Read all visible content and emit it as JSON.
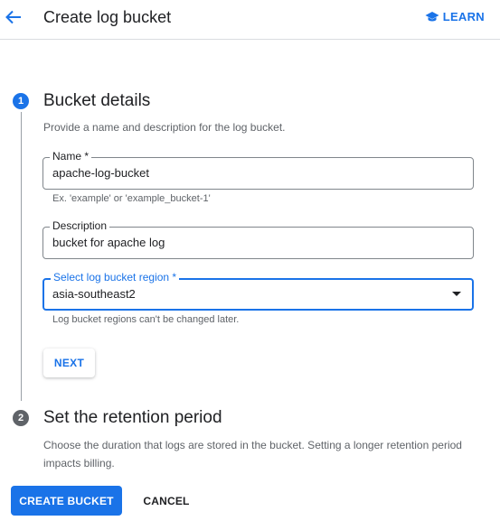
{
  "header": {
    "title": "Create log bucket",
    "learn_label": "LEARN",
    "back_icon": "arrow-left-icon",
    "learn_icon": "school-cap-icon"
  },
  "steps": [
    {
      "number": "1",
      "title": "Bucket details",
      "description": "Provide a name and description for the log bucket."
    },
    {
      "number": "2",
      "title": "Set the retention period",
      "description": "Choose the duration that logs are stored in the bucket. Setting a longer retention period impacts billing."
    }
  ],
  "form": {
    "name": {
      "label": "Name *",
      "value": "apache-log-bucket",
      "hint": "Ex. 'example' or 'example_bucket-1'"
    },
    "description": {
      "label": "Description",
      "value": "bucket for apache log"
    },
    "region": {
      "label": "Select log bucket region *",
      "value": "asia-southeast2",
      "hint": "Log bucket regions can't be changed later."
    },
    "next_label": "NEXT"
  },
  "footer": {
    "create_label": "CREATE BUCKET",
    "cancel_label": "CANCEL"
  },
  "colors": {
    "accent": "#1a73e8",
    "step_inactive": "#5f6368",
    "text": "#202124",
    "secondary_text": "#5f6368"
  }
}
